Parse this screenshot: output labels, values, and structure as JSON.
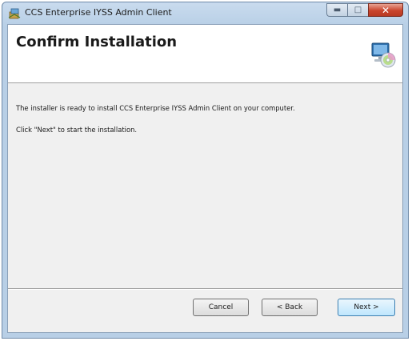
{
  "window": {
    "title": "CCS Enterprise IYSS Admin Client"
  },
  "header": {
    "title": "Confirm Installation",
    "icon": "computer-cd-icon"
  },
  "content": {
    "line1": "The installer is ready to install CCS Enterprise IYSS Admin Client on your computer.",
    "line2": "Click \"Next\" to start the installation."
  },
  "buttons": {
    "cancel": "Cancel",
    "back": "< Back",
    "next": "Next >"
  },
  "colors": {
    "title_bar": "#b8cfe6",
    "close_button": "#c9452d",
    "dialog_background": "#f0f0f0"
  }
}
